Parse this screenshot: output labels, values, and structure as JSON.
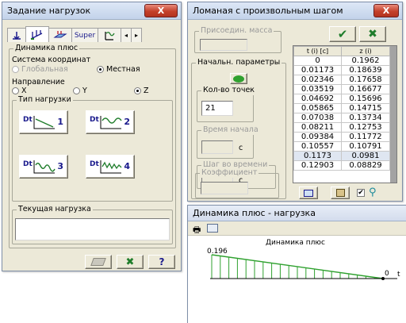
{
  "load_dialog": {
    "title": "Задание нагрузок",
    "close_label": "X",
    "tabs": [
      {
        "icon": "node-load-icon",
        "label": ""
      },
      {
        "icon": "beam-load-icon",
        "label": ""
      },
      {
        "icon": "plate-load-icon",
        "label": ""
      },
      {
        "icon": "",
        "label": "Super"
      },
      {
        "icon": "dynamic-load-icon",
        "label": ""
      }
    ],
    "group_title": "Динамика плюс",
    "coord_label": "Система координат",
    "coord_options": [
      {
        "label": "Глобальная",
        "selected": false,
        "disabled": true
      },
      {
        "label": "Местная",
        "selected": true,
        "disabled": false
      }
    ],
    "direction_label": "Направление",
    "direction_options": [
      {
        "label": "X",
        "selected": false
      },
      {
        "label": "Y",
        "selected": false
      },
      {
        "label": "Z",
        "selected": true
      }
    ],
    "load_type_label": "Тип нагрузки",
    "load_types": [
      {
        "prefix": "Dt",
        "number": "1"
      },
      {
        "prefix": "Dt",
        "number": "2"
      },
      {
        "prefix": "Dt",
        "number": "3"
      },
      {
        "prefix": "Dt",
        "number": "4"
      }
    ],
    "current_load_label": "Текущая нагрузка",
    "current_load_value": "",
    "ok_label": "✔",
    "cancel_label": "✖",
    "help_label": "?"
  },
  "polyline_dialog": {
    "title": "Ломаная с произвольным шагом",
    "close_label": "X",
    "attached_mass_label": "Присоедин. масса",
    "initial_params_label": "Начальн. параметры",
    "points_count_label": "Кол-во точек",
    "points_count_value": "21",
    "start_time_label": "Время начала",
    "time_step_label": "Шаг во времени",
    "unit_c": "c",
    "coefficient_label": "Коэффициент",
    "table_headers": [
      "t (i) [c]",
      "z (i)"
    ],
    "table_rows": [
      [
        "0",
        "0.1962"
      ],
      [
        "0.01173",
        "0.18639"
      ],
      [
        "0.02346",
        "0.17658"
      ],
      [
        "0.03519",
        "0.16677"
      ],
      [
        "0.04692",
        "0.15696"
      ],
      [
        "0.05865",
        "0.14715"
      ],
      [
        "0.07038",
        "0.13734"
      ],
      [
        "0.08211",
        "0.12753"
      ],
      [
        "0.09384",
        "0.11772"
      ],
      [
        "0.10557",
        "0.10791"
      ],
      [
        "0.1173",
        "0.0981"
      ],
      [
        "0.12903",
        "0.08829"
      ]
    ],
    "checkbox_checked": true
  },
  "chart_window": {
    "title": "Динамика плюс - нагрузка",
    "chart_title": "Динамика плюс",
    "peak_label": "0.196",
    "end_label": "0",
    "t_label": "t"
  },
  "chart_data": {
    "type": "area",
    "title": "Динамика плюс",
    "x": [
      0,
      1
    ],
    "values": [
      0.196,
      0
    ],
    "annotations": [
      "0.196",
      "0",
      "t"
    ]
  },
  "colors": {
    "accent_green": "#1f7d2b",
    "close_red": "#c4412b",
    "chart_line": "#2fa12f"
  }
}
